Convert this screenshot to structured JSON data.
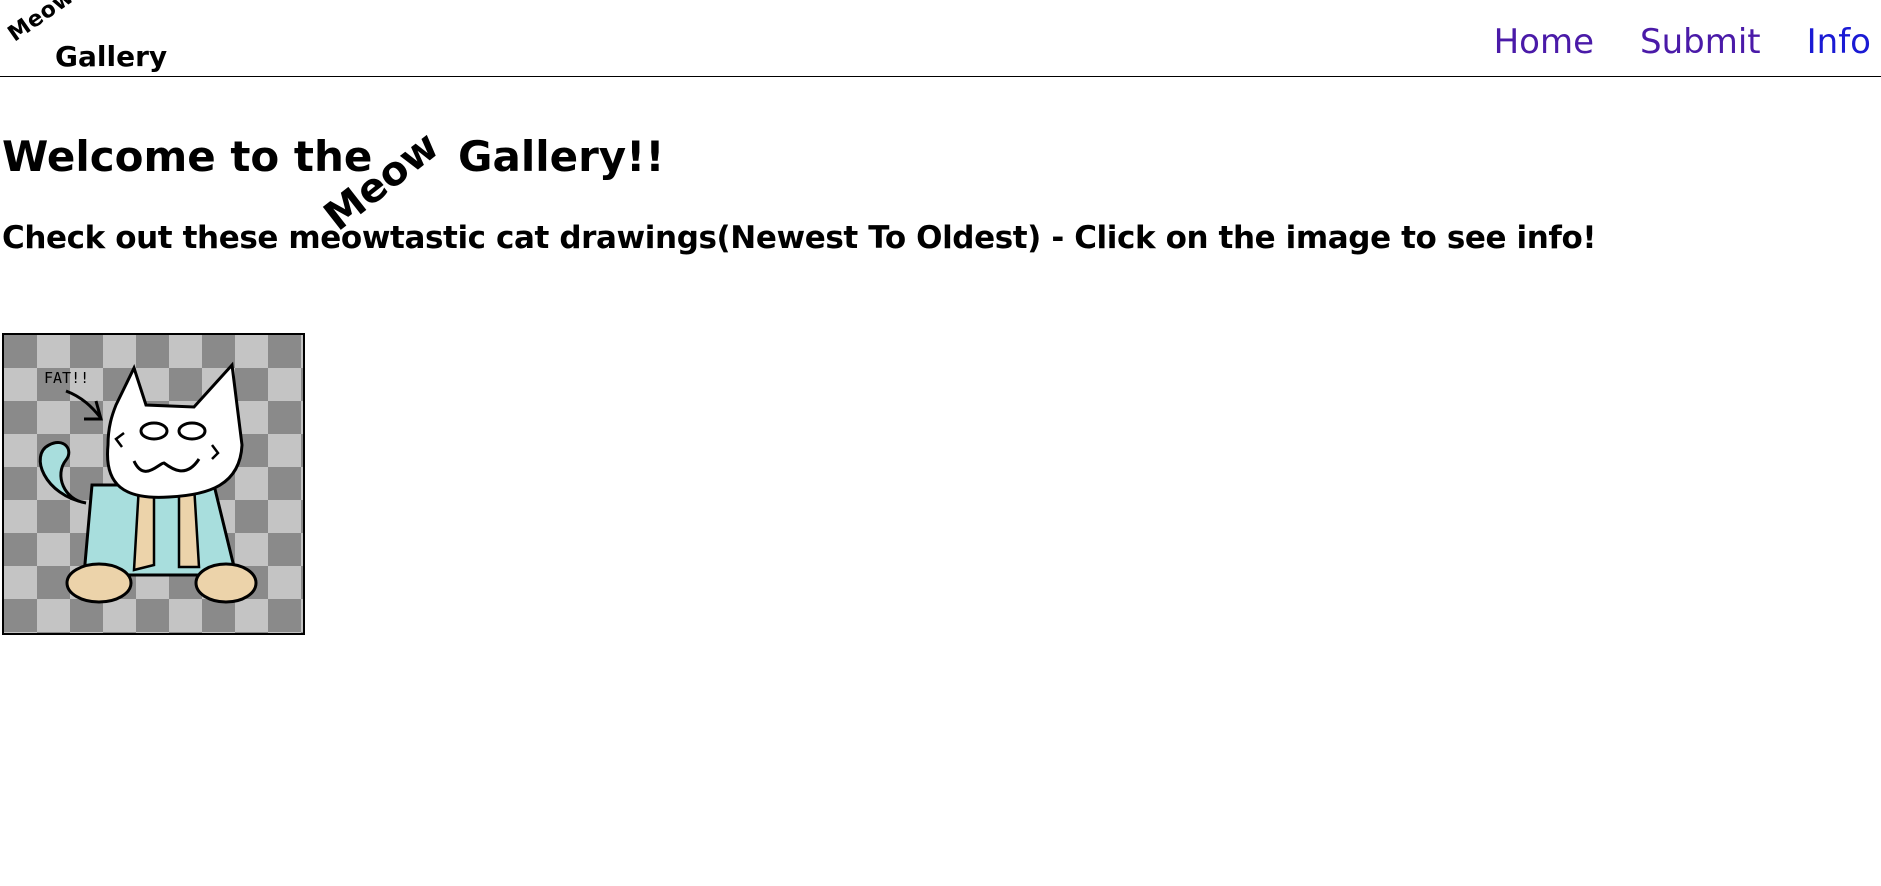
{
  "header": {
    "logo_top": "Meow",
    "logo_bottom": "Gallery",
    "nav": {
      "home": "Home",
      "submit": "Submit",
      "info": "Info"
    }
  },
  "main": {
    "title_prefix": "Welcome to the",
    "title_meow": "Meow",
    "title_suffix": "Gallery!!",
    "subtitle": "Check out these meowtastic cat drawings(Newest To Oldest) - Click on the image to see info!",
    "gallery": [
      {
        "caption": "FAT!!"
      }
    ]
  },
  "colors": {
    "nav_link": "#4a1aa8",
    "nav_info": "#1a1ad4",
    "checker_dark": "#8a8a8a",
    "checker_light": "#c4c4c4",
    "cat_body": "#a8dedd",
    "cat_paws": "#ecd3aa"
  }
}
